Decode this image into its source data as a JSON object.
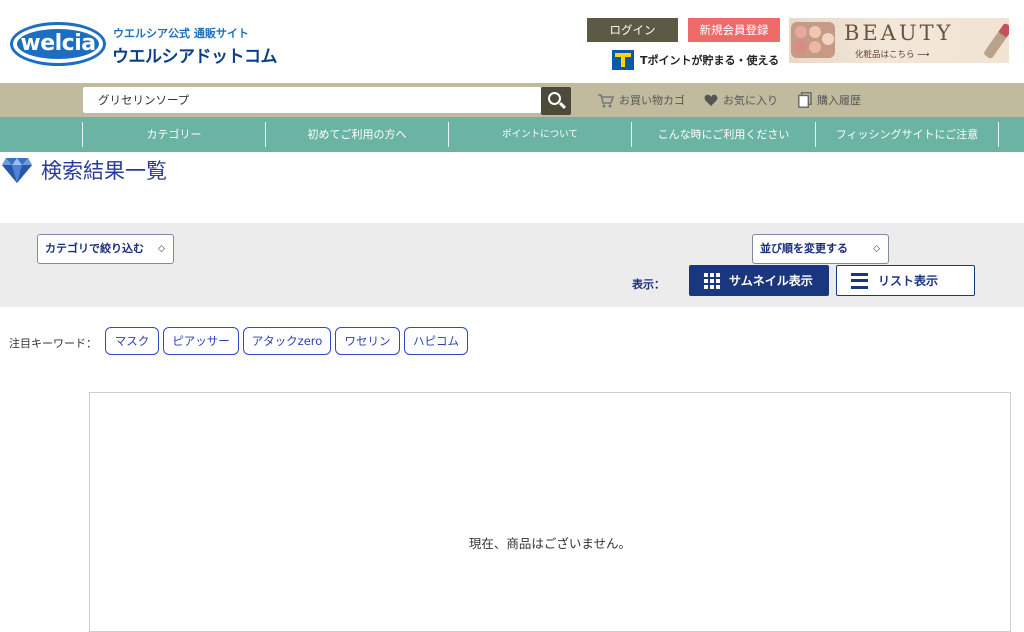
{
  "header": {
    "logo_text": "welcia",
    "logo_sub": "ウエルシア公式 通販サイト",
    "logo_main": "ウエルシアドットコム",
    "login_label": "ログイン",
    "register_label": "新規会員登録",
    "tpoint_text": "Tポイントが貯まる・使える",
    "banner_title": "BEAUTY",
    "banner_sub": "化粧品はこちら ⟶"
  },
  "search": {
    "value": "グリセリンソープ",
    "cart_label": "お買い物カゴ",
    "favorites_label": "お気に入り",
    "history_label": "購入履歴"
  },
  "nav": {
    "items": [
      "カテゴリー",
      "初めてご利用の方へ",
      "ポイントについて",
      "こんな時にご利用ください",
      "フィッシングサイトにご注意"
    ]
  },
  "page": {
    "title": "検索結果一覧"
  },
  "filters": {
    "category_select": "カテゴリで絞り込む",
    "sort_select": "並び順を変更する",
    "display_label": "表示：",
    "thumbnail_label": "サムネイル表示",
    "list_label": "リスト表示"
  },
  "keywords": {
    "label": "注目キーワード：",
    "items": [
      "マスク",
      "ピアッサー",
      "アタックzero",
      "ワセリン",
      "ハピコム"
    ]
  },
  "results": {
    "empty_message": "現在、商品はございません。"
  },
  "colors": {
    "nav_bg": "#6bb4a3",
    "search_bar_bg": "#c0bb9f",
    "primary_navy": "#19367f",
    "register_red": "#ef6a69",
    "login_olive": "#5c5a45"
  }
}
